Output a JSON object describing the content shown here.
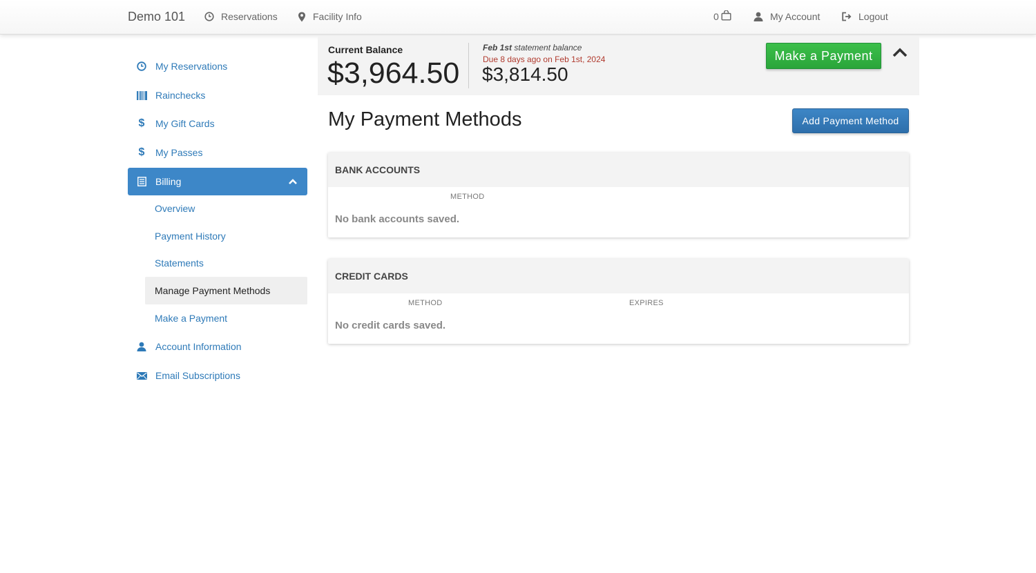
{
  "nav": {
    "brand": "Demo 101",
    "reservations": "Reservations",
    "facility_info": "Facility Info",
    "cart_count": "0",
    "my_account": "My Account",
    "logout": "Logout"
  },
  "sidebar": {
    "items": [
      {
        "label": "My Reservations",
        "icon": "clock-icon"
      },
      {
        "label": "Rainchecks",
        "icon": "barcode-icon"
      },
      {
        "label": "My Gift Cards",
        "icon": "dollar-icon"
      },
      {
        "label": "My Passes",
        "icon": "dollar-icon"
      },
      {
        "label": "Billing",
        "icon": "list-icon"
      },
      {
        "label": "Account Information",
        "icon": "user-icon"
      },
      {
        "label": "Email Subscriptions",
        "icon": "envelope-icon"
      }
    ],
    "billing_sub": [
      {
        "label": "Overview"
      },
      {
        "label": "Payment History"
      },
      {
        "label": "Statements"
      },
      {
        "label": "Manage Payment Methods"
      },
      {
        "label": "Make a Payment"
      }
    ]
  },
  "balance": {
    "current_label": "Current Balance",
    "current_amount": "$3,964.50",
    "statement_date": "Feb 1st",
    "statement_suffix": "statement balance",
    "due_text": "Due 8 days ago on Feb 1st, 2024",
    "statement_amount": "$3,814.50",
    "pay_button": "Make a Payment"
  },
  "main": {
    "title": "My Payment Methods",
    "add_button": "Add Payment Method",
    "bank": {
      "heading": "BANK ACCOUNTS",
      "col_method": "METHOD",
      "empty": "No bank accounts saved."
    },
    "cards": {
      "heading": "CREDIT CARDS",
      "col_method": "METHOD",
      "col_expires": "EXPIRES",
      "empty": "No credit cards saved."
    }
  },
  "colors": {
    "link_blue": "#2e7ab8",
    "active_blue": "#3d87c8",
    "pay_green": "#2aa53a",
    "due_red": "#b03a2e"
  }
}
